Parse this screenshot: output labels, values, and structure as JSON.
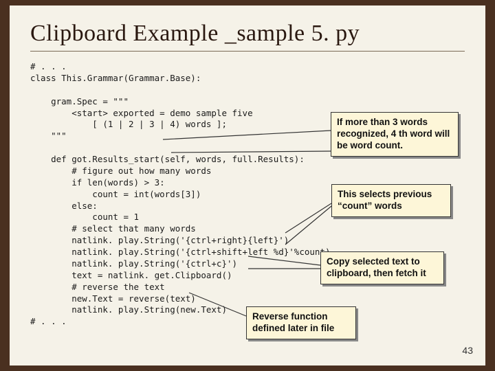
{
  "title": "Clipboard Example _sample 5. py",
  "code": "# . . .\nclass This.Grammar(Grammar.Base):\n\n    gram.Spec = \"\"\"\n        <start> exported = demo sample five\n            [ (1 | 2 | 3 | 4) words ];\n    \"\"\"\n\n    def got.Results_start(self, words, full.Results):\n        # figure out how many words\n        if len(words) > 3:\n            count = int(words[3])\n        else:\n            count = 1\n        # select that many words\n        natlink. play.String('{ctrl+right}{left}')\n        natlink. play.String('{ctrl+shift+left %d}'%count)\n        natlink. play.String('{ctrl+c}')\n        text = natlink. get.Clipboard()\n        # reverse the text\n        new.Text = reverse(text)\n        natlink. play.String(new.Text)\n# . . .",
  "callouts": {
    "c1": "If more than 3 words recognized, 4 th word will be word count.",
    "c2": "This selects previous “count” words",
    "c3": "Copy selected text to clipboard, then fetch it",
    "c4": "Reverse function defined later in file"
  },
  "slidenum": "43"
}
